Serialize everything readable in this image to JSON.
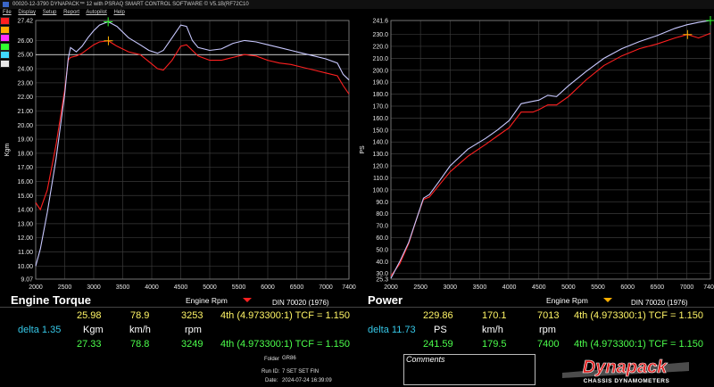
{
  "window": {
    "title": "00020-12-3790 DYNAPACK™ 12 with PSRAQ SMART CONTROL SOFTWARE © V5.1B(RF72C10",
    "menu": [
      "File",
      "Display",
      "Setup",
      "Report",
      "Autopilot",
      "Help"
    ]
  },
  "swatches": [
    "#ff2020",
    "#ffb000",
    "#ff30ff",
    "#30ff30",
    "#40d8ff",
    "#e8e8e8"
  ],
  "torque_panel": {
    "title": "Engine Torque",
    "rpm_label": "Engine Rpm",
    "din": "DIN 70020 (1976)"
  },
  "power_panel": {
    "title": "Power",
    "rpm_label": "Engine Rpm",
    "din": "DIN 70020 (1976)"
  },
  "readouts": {
    "torque": {
      "run1": {
        "value": "25.98",
        "speed": "78.9",
        "rpm": "3253",
        "gear": "4th (4.973300:1) TCF = 1.150"
      },
      "delta": "delta 1.35",
      "units": {
        "value": "Kgm",
        "speed": "km/h",
        "rpm": "rpm"
      },
      "run2": {
        "value": "27.33",
        "speed": "78.8",
        "rpm": "3249",
        "gear": "4th (4.973300:1) TCF = 1.150"
      }
    },
    "power": {
      "run1": {
        "value": "229.86",
        "speed": "170.1",
        "rpm": "7013",
        "gear": "4th (4.973300:1) TCF = 1.150"
      },
      "delta": "delta 11.73",
      "units": {
        "value": "PS",
        "speed": "km/h",
        "rpm": "rpm"
      },
      "run2": {
        "value": "241.59",
        "speed": "179.5",
        "rpm": "7400",
        "gear": "4th (4.973300:1) TCF = 1.150"
      }
    }
  },
  "info": {
    "folder_label": "Folder",
    "folder": "GR86",
    "runid_label": "Run ID:",
    "runid": "7 SET SET FIN",
    "date_label": "Date:",
    "date": "2024-07-24 16:39:09"
  },
  "comments_label": "Comments",
  "logo": {
    "text": "Dynapack",
    "subtext": "CHASSIS DYNAMOMETERS"
  },
  "chart_data": [
    {
      "type": "line",
      "ylabel": "Kgm",
      "xlabel": "Engine Rpm",
      "xlim": [
        2000,
        7400
      ],
      "ylim": [
        9.07,
        27.42
      ],
      "xticks": [
        "2000",
        "2500",
        "3000",
        "3500",
        "4000",
        "4500",
        "5000",
        "5500",
        "6000",
        "6500",
        "7000",
        "7400"
      ],
      "yticks": [
        "9.07",
        "10.00",
        "11.00",
        "12.00",
        "13.00",
        "14.00",
        "15.00",
        "16.00",
        "17.00",
        "18.00",
        "19.00",
        "20.00",
        "21.00",
        "22.00",
        "23.00",
        "24.00",
        "25.00",
        "26.00",
        "27.42"
      ],
      "marker_lines": [
        {
          "axis": "y",
          "value": 25.0,
          "color": "#ffffff"
        }
      ],
      "series": [
        {
          "color": "#ff2020",
          "x": [
            2000,
            2080,
            2200,
            2350,
            2500,
            2560,
            2600,
            2700,
            2800,
            2900,
            3000,
            3100,
            3253,
            3400,
            3600,
            3800,
            3950,
            4100,
            4200,
            4350,
            4500,
            4600,
            4700,
            4800,
            5000,
            5200,
            5400,
            5600,
            5800,
            6000,
            6200,
            6400,
            6600,
            6800,
            7000,
            7200,
            7300,
            7400
          ],
          "y": [
            14.5,
            14.0,
            15.4,
            18.6,
            22.5,
            24.6,
            24.8,
            24.9,
            25.1,
            25.4,
            25.7,
            25.9,
            25.98,
            25.6,
            25.2,
            25.0,
            24.5,
            24.0,
            23.9,
            24.6,
            25.6,
            25.7,
            25.3,
            24.9,
            24.6,
            24.6,
            24.8,
            25.0,
            24.9,
            24.6,
            24.4,
            24.3,
            24.1,
            23.9,
            23.7,
            23.5,
            22.8,
            22.2
          ]
        },
        {
          "color": "#c8c8ff",
          "x": [
            2000,
            2080,
            2200,
            2350,
            2500,
            2560,
            2600,
            2700,
            2800,
            2900,
            3000,
            3100,
            3249,
            3400,
            3600,
            3800,
            3950,
            4100,
            4200,
            4350,
            4500,
            4600,
            4700,
            4800,
            5000,
            5200,
            5400,
            5600,
            5800,
            6000,
            6200,
            6400,
            6600,
            6800,
            7000,
            7200,
            7300,
            7400
          ],
          "y": [
            10.0,
            11.2,
            13.8,
            17.6,
            22.2,
            24.7,
            25.5,
            25.2,
            25.6,
            26.2,
            26.7,
            27.1,
            27.33,
            27.0,
            26.2,
            25.7,
            25.3,
            25.1,
            25.3,
            26.2,
            27.1,
            27.0,
            26.0,
            25.5,
            25.3,
            25.4,
            25.8,
            26.0,
            25.9,
            25.7,
            25.5,
            25.3,
            25.1,
            24.9,
            24.7,
            24.4,
            23.6,
            23.2
          ]
        }
      ],
      "cursors": [
        {
          "x": 3253,
          "y": 25.98,
          "color": "#ffb000"
        },
        {
          "x": 3249,
          "y": 27.33,
          "color": "#30ff30"
        }
      ]
    },
    {
      "type": "line",
      "ylabel": "PS",
      "xlabel": "Engine Rpm",
      "xlim": [
        2000,
        7400
      ],
      "ylim": [
        25.3,
        241.6
      ],
      "xticks": [
        "2000",
        "2500",
        "3000",
        "3500",
        "4000",
        "4500",
        "5000",
        "5500",
        "6000",
        "6500",
        "7000",
        "7400"
      ],
      "yticks": [
        "25.3",
        "30.0",
        "40.0",
        "50.0",
        "60.0",
        "70.0",
        "80.0",
        "90.0",
        "100.0",
        "110.0",
        "120.0",
        "130.0",
        "140.0",
        "150.0",
        "160.0",
        "170.0",
        "180.0",
        "190.0",
        "200.0",
        "210.0",
        "220.0",
        "230.0",
        "241.6"
      ],
      "series": [
        {
          "color": "#ff2020",
          "x": [
            2000,
            2150,
            2300,
            2450,
            2550,
            2650,
            2800,
            3000,
            3300,
            3600,
            3800,
            4000,
            4200,
            4400,
            4500,
            4650,
            4800,
            5000,
            5300,
            5600,
            5900,
            6200,
            6500,
            6800,
            7013,
            7200,
            7400
          ],
          "y": [
            28,
            38,
            55,
            78,
            92,
            94,
            103,
            115,
            128,
            138,
            145,
            152,
            165,
            165,
            167,
            171,
            171,
            178,
            192,
            204,
            212,
            218,
            222,
            227,
            229.86,
            227,
            231
          ]
        },
        {
          "color": "#c8c8ff",
          "x": [
            2000,
            2150,
            2300,
            2450,
            2550,
            2650,
            2800,
            3000,
            3300,
            3600,
            3800,
            4000,
            4200,
            4400,
            4500,
            4650,
            4800,
            5000,
            5300,
            5600,
            5900,
            6200,
            6500,
            6800,
            7000,
            7200,
            7400
          ],
          "y": [
            26,
            40,
            56,
            78,
            93,
            96,
            106,
            120,
            134,
            143,
            150,
            158,
            172,
            174,
            175,
            179,
            178,
            187,
            199,
            210,
            218,
            224,
            229,
            235,
            238,
            240,
            241.59
          ]
        }
      ],
      "cursors": [
        {
          "x": 7013,
          "y": 229.86,
          "color": "#ffb000"
        },
        {
          "x": 7400,
          "y": 241.59,
          "color": "#30ff30"
        }
      ]
    }
  ]
}
